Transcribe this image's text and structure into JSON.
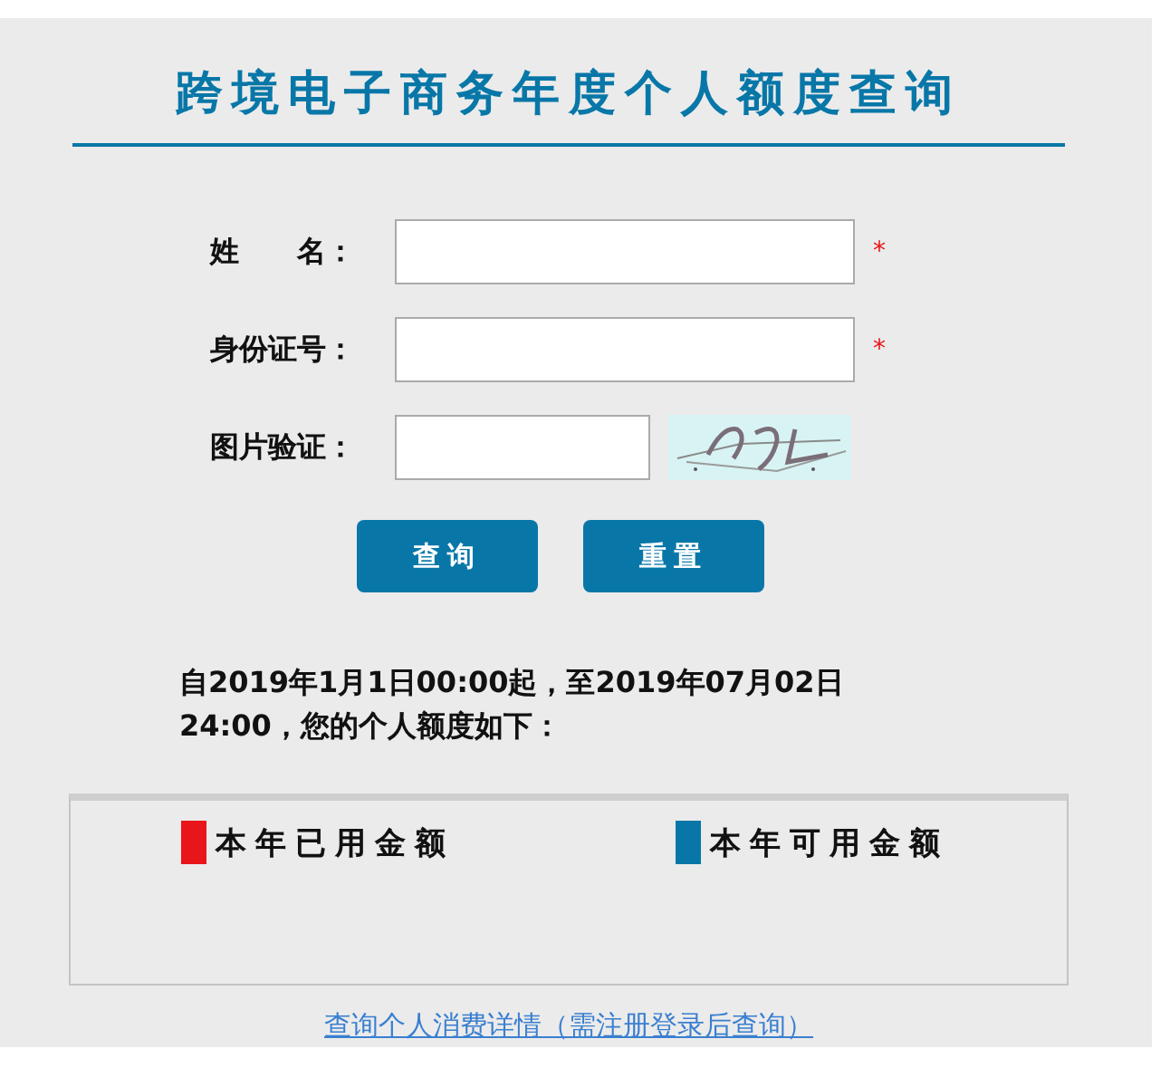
{
  "title": "跨境电子商务年度个人额度查询",
  "form": {
    "fields": [
      {
        "label": "姓　　名：",
        "mark": "*",
        "kind": "text"
      },
      {
        "label": "身份证号：",
        "mark": "*",
        "kind": "text"
      },
      {
        "label": "图片验证：",
        "kind": "captcha"
      }
    ],
    "buttons": [
      "查询",
      "重置"
    ]
  },
  "notice": "自2019年1月1日00:00起，至2019年07月02日24:00，您的个人额度如下：",
  "legend": [
    {
      "label": "本年已用金额",
      "color": "#e8151b"
    },
    {
      "label": "本年可用金额",
      "color": "#0877a8"
    }
  ],
  "link": "查询个人消费详情（需注册登录后查询）"
}
